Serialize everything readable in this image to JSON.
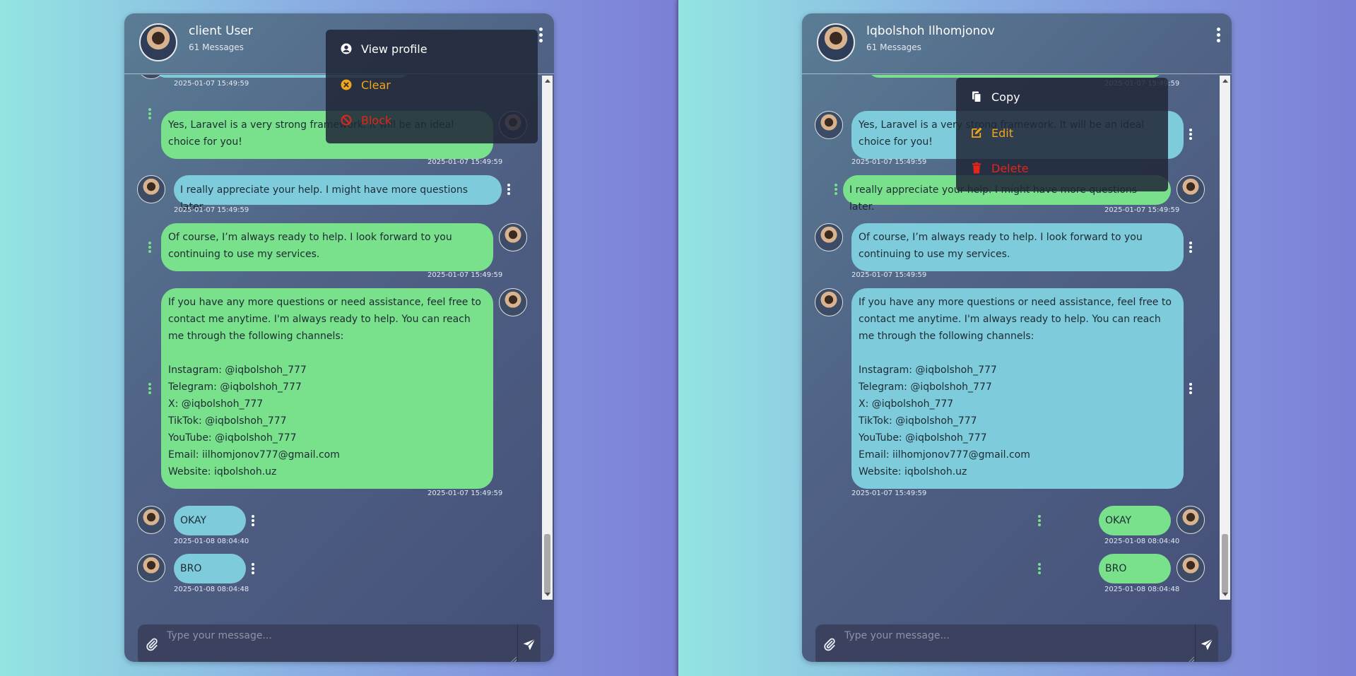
{
  "left": {
    "header": {
      "name": "client User",
      "count": "61 Messages"
    },
    "messages": [
      {
        "text": "Yes, Laravel is a very strong framework. It will be an ideal choice for you!",
        "time": "2025-01-07 15:49:59"
      },
      {
        "text": "I really appreciate your help. I might have more questions later.",
        "time": "2025-01-07 15:49:59"
      },
      {
        "text": "Of course, I’m always ready to help. I look forward to you continuing to use my services.",
        "time": "2025-01-07 15:49:59"
      },
      {
        "text": "If you have any more questions or need assistance, feel free to contact me anytime. I'm always ready to help. You can reach me through the following channels:\n\nInstagram: @iqbolshoh_777\nTelegram: @iqbolshoh_777\nX: @iqbolshoh_777\nTikTok: @iqbolshoh_777\nYouTube: @iqbolshoh_777\nEmail: iilhomjonov777@gmail.com\nWebsite: iqbolshoh.uz",
        "time": "2025-01-07 15:49:59"
      },
      {
        "text": "OKAY",
        "time": "2025-01-08 08:04:40"
      },
      {
        "text": "BRO",
        "time": "2025-01-08 08:04:48"
      }
    ],
    "top_time": "2025-01-07 15:49:59",
    "menu": {
      "view_profile": "View profile",
      "clear": "Clear",
      "block": "Block"
    },
    "input": {
      "placeholder": "Type your message..."
    }
  },
  "right": {
    "header": {
      "name": "Iqbolshoh Ilhomjonov",
      "count": "61 Messages"
    },
    "messages": [
      {
        "text": "Yes, Laravel is a very strong framework. It will be an ideal choice for you!",
        "time": "2025-01-07 15:49:59"
      },
      {
        "text": "I really appreciate your help. I might have more questions later.",
        "time": "2025-01-07 15:49:59"
      },
      {
        "text": "Of course, I’m always ready to help. I look forward to you continuing to use my services.",
        "time": "2025-01-07 15:49:59"
      },
      {
        "text": "If you have any more questions or need assistance, feel free to contact me anytime. I'm always ready to help. You can reach me through the following channels:\n\nInstagram: @iqbolshoh_777\nTelegram: @iqbolshoh_777\nX: @iqbolshoh_777\nTikTok: @iqbolshoh_777\nYouTube: @iqbolshoh_777\nEmail: iilhomjonov777@gmail.com\nWebsite: iqbolshoh.uz",
        "time": "2025-01-07 15:49:59"
      },
      {
        "text": "OKAY",
        "time": "2025-01-08 08:04:40"
      },
      {
        "text": "BRO",
        "time": "2025-01-08 08:04:48"
      }
    ],
    "top_time": "2025-01-07 15:49:59",
    "menu": {
      "copy": "Copy",
      "edit": "Edit",
      "delete": "Delete"
    },
    "input": {
      "placeholder": "Type your message..."
    }
  },
  "colors": {
    "own_bubble": "#79e08c",
    "other_bubble": "#7ecbdc",
    "menu_warning": "#f3a516",
    "menu_danger": "#e3251b"
  },
  "icons": [
    "more-vertical-icon",
    "user-circle-icon",
    "x-circle-icon",
    "ban-icon",
    "copy-icon",
    "edit-icon",
    "trash-icon",
    "paperclip-icon",
    "send-icon"
  ]
}
